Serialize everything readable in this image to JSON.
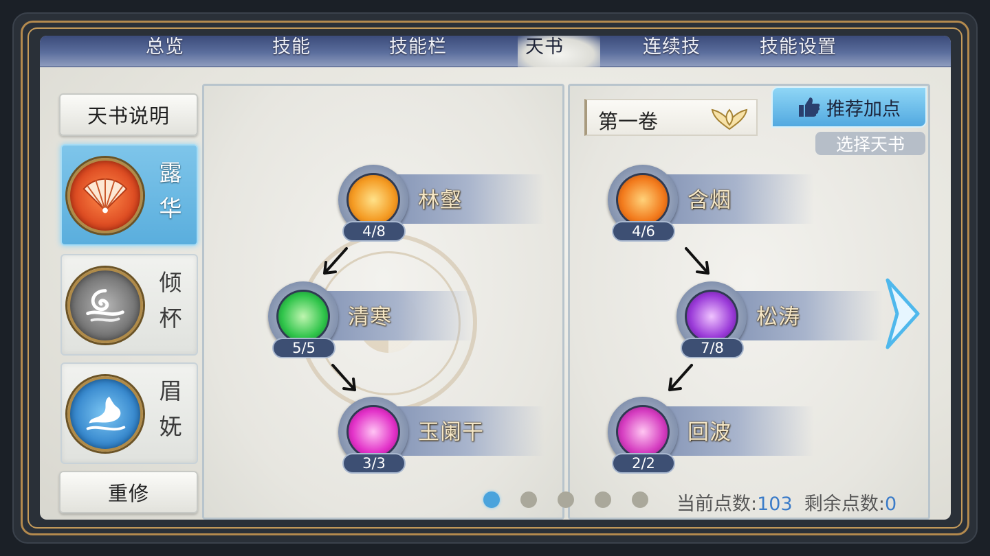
{
  "tabs": [
    {
      "label": "总览",
      "active": false
    },
    {
      "label": "技能",
      "active": false
    },
    {
      "label": "技能栏",
      "active": false
    },
    {
      "label": "天书",
      "active": true
    },
    {
      "label": "连续技",
      "active": false
    },
    {
      "label": "技能设置",
      "active": false
    }
  ],
  "sidebar": {
    "intro_button": "天书说明",
    "books": [
      {
        "name": "露华",
        "icon": "fan-icon",
        "selected": true
      },
      {
        "name": "倾杯",
        "icon": "swirl-icon",
        "selected": false
      },
      {
        "name": "眉妩",
        "icon": "phoenix-icon",
        "selected": false
      }
    ],
    "reset_button": "重修"
  },
  "left_tree": [
    {
      "name": "林壑",
      "level": "4/8",
      "icon": "golden-dragon-icon"
    },
    {
      "name": "清寒",
      "level": "5/5",
      "icon": "meditating-figure-icon"
    },
    {
      "name": "玉阑干",
      "level": "3/3",
      "icon": "magenta-vortex-icon"
    }
  ],
  "right_tree": [
    {
      "name": "含烟",
      "level": "4/6",
      "icon": "fire-spirit-icon"
    },
    {
      "name": "松涛",
      "level": "7/8",
      "icon": "purple-crystal-icon"
    },
    {
      "name": "回波",
      "level": "2/2",
      "icon": "pink-dancer-icon"
    }
  ],
  "volume": {
    "label": "第一卷",
    "icon": "lotus-dropdown-icon"
  },
  "recommend_button": "推荐加点",
  "select_book_button": "选择天书",
  "pagination": {
    "pages": 5,
    "current": 1
  },
  "points": {
    "current_label": "当前点数:",
    "current_value": "103",
    "remaining_label": "剩余点数:",
    "remaining_value": "0"
  },
  "colors": {
    "accent_blue": "#4aa3dc",
    "gold_text": "#f4e6c6",
    "tab_bar": "#3b4b7a"
  }
}
